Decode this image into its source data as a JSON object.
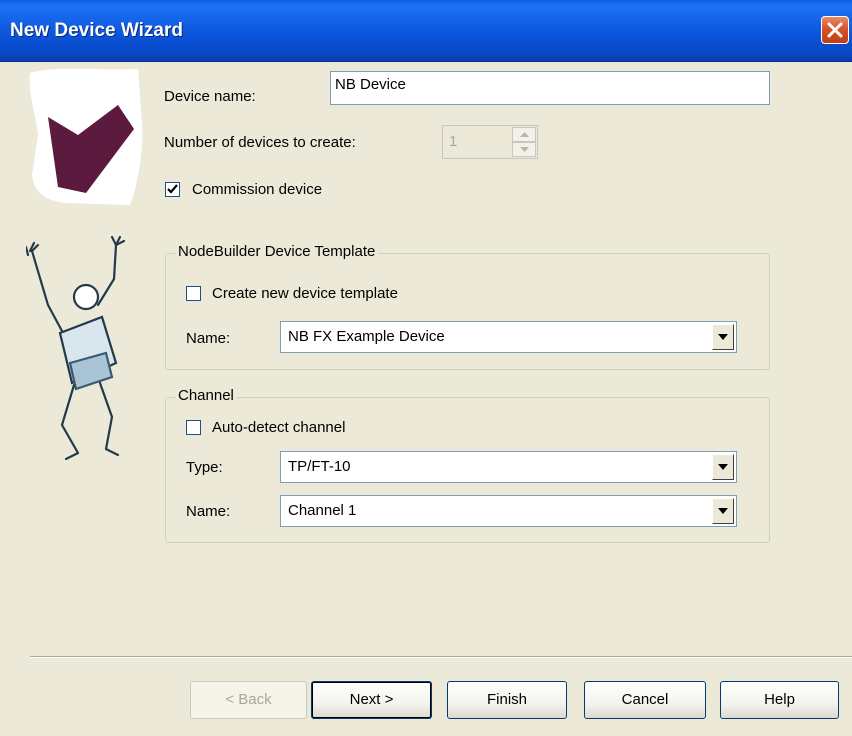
{
  "window": {
    "title": "New Device Wizard"
  },
  "device": {
    "name_label": "Device name:",
    "name_value": "NB Device",
    "count_label": "Number of devices to create:",
    "count_value": "1",
    "commission_label": "Commission device",
    "commission_checked": true
  },
  "template_group": {
    "legend": "NodeBuilder Device Template",
    "create_label": "Create new device template",
    "create_checked": false,
    "name_label": "Name:",
    "name_value": "NB FX Example Device"
  },
  "channel_group": {
    "legend": "Channel",
    "autodetect_label": "Auto-detect channel",
    "autodetect_checked": false,
    "type_label": "Type:",
    "type_value": "TP/FT-10",
    "name_label": "Name:",
    "name_value": "Channel 1"
  },
  "buttons": {
    "back": "< Back",
    "next": "Next >",
    "finish": "Finish",
    "cancel": "Cancel",
    "help": "Help"
  },
  "icons": {
    "close": "close-icon",
    "check": "checkmark-icon",
    "dropdown": "dropdown-arrow-icon",
    "spin_up": "spin-up-icon",
    "spin_down": "spin-down-icon"
  },
  "colors": {
    "titlebar": "#0b56dc",
    "dialog_bg": "#ece9d8",
    "close_button": "#d8532c",
    "field_border": "#7f9db9"
  }
}
